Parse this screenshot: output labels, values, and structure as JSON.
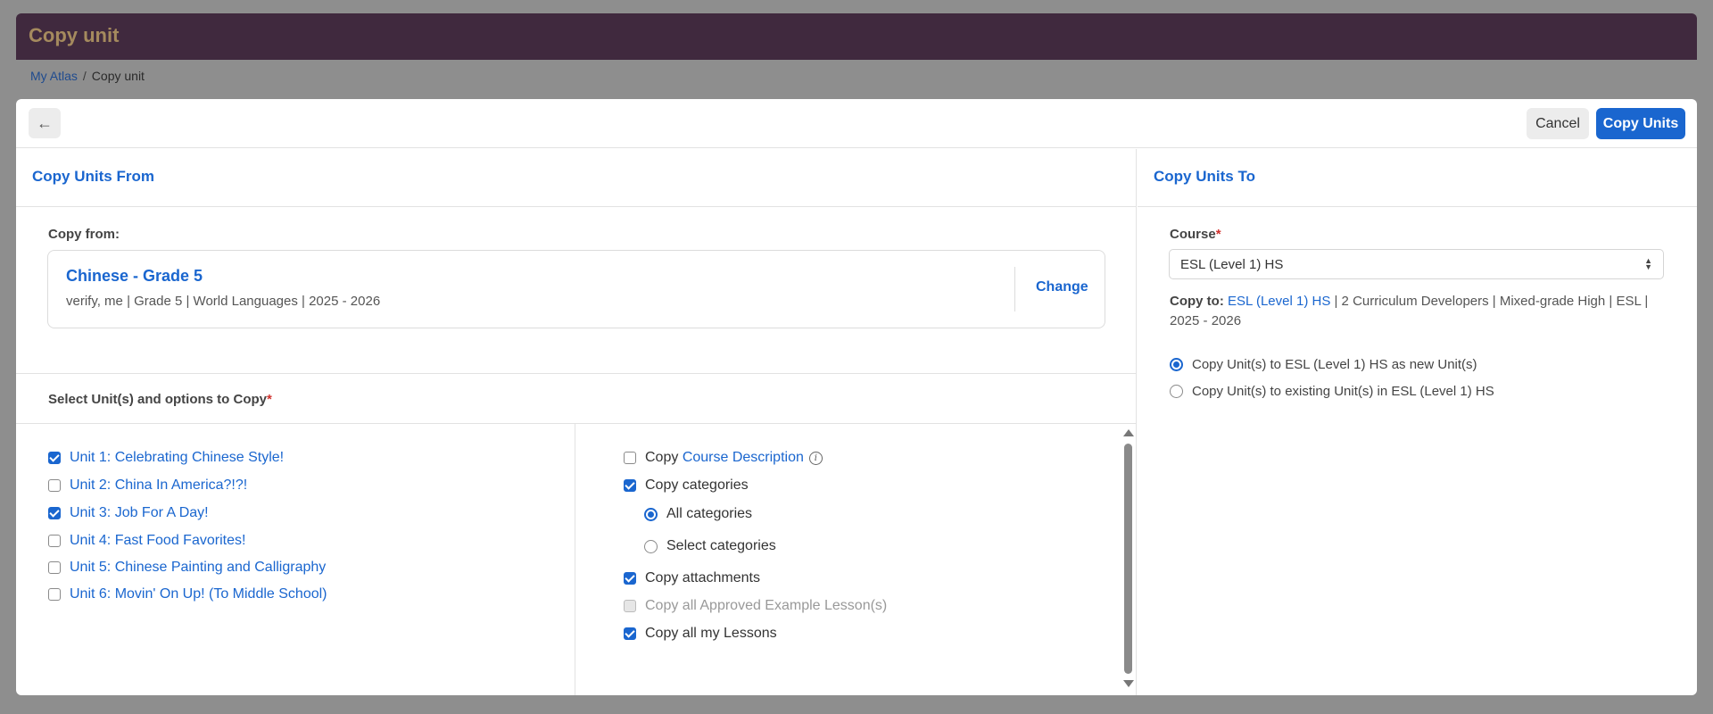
{
  "app": {
    "title": "Copy unit"
  },
  "breadcrumb": {
    "home": "My Atlas",
    "separator": "/",
    "current": "Copy unit"
  },
  "toolbar": {
    "back_glyph": "←",
    "cancel_label": "Cancel",
    "copy_label": "Copy Units"
  },
  "from": {
    "section_title": "Copy Units From",
    "label": "Copy from:",
    "card_title": "Chinese - Grade 5",
    "card_meta": "verify, me | Grade 5 | World Languages | 2025 - 2026",
    "change_label": "Change"
  },
  "select": {
    "label": "Select Unit(s) and options to Copy",
    "required": "*"
  },
  "units": [
    {
      "label": "Unit 1: Celebrating Chinese Style!",
      "checked": true
    },
    {
      "label": "Unit 2: China In America?!?!",
      "checked": false
    },
    {
      "label": "Unit 3: Job For A Day!",
      "checked": true
    },
    {
      "label": "Unit 4: Fast Food Favorites!",
      "checked": false
    },
    {
      "label": "Unit 5: Chinese Painting and Calligraphy",
      "checked": false
    },
    {
      "label": "Unit 6: Movin' On Up! (To Middle School)",
      "checked": false
    }
  ],
  "options": {
    "copy_desc_prefix": "Copy",
    "copy_desc_link": "Course Description",
    "info_glyph": "i",
    "copy_categories": "Copy categories",
    "all_categories": "All categories",
    "select_categories": "Select categories",
    "copy_attachments": "Copy attachments",
    "copy_approved": "Copy all Approved Example Lesson(s)",
    "copy_lessons": "Copy all my Lessons"
  },
  "to": {
    "section_title": "Copy Units To",
    "course_label": "Course",
    "required": "*",
    "course_value": "ESL (Level 1) HS",
    "copy_to_label": "Copy to:",
    "copy_to_link": "ESL (Level 1) HS",
    "copy_to_meta": " | 2 Curriculum Developers | Mixed-grade High | ESL | 2025 - 2026",
    "radio_new": "Copy Unit(s) to ESL (Level 1) HS as new Unit(s)",
    "radio_existing": "Copy Unit(s) to existing Unit(s) in ESL (Level 1) HS"
  },
  "colors": {
    "accent": "#1a66cf",
    "header": "#40293e",
    "title_gold": "#a58a5e",
    "required": "#d0312d"
  }
}
